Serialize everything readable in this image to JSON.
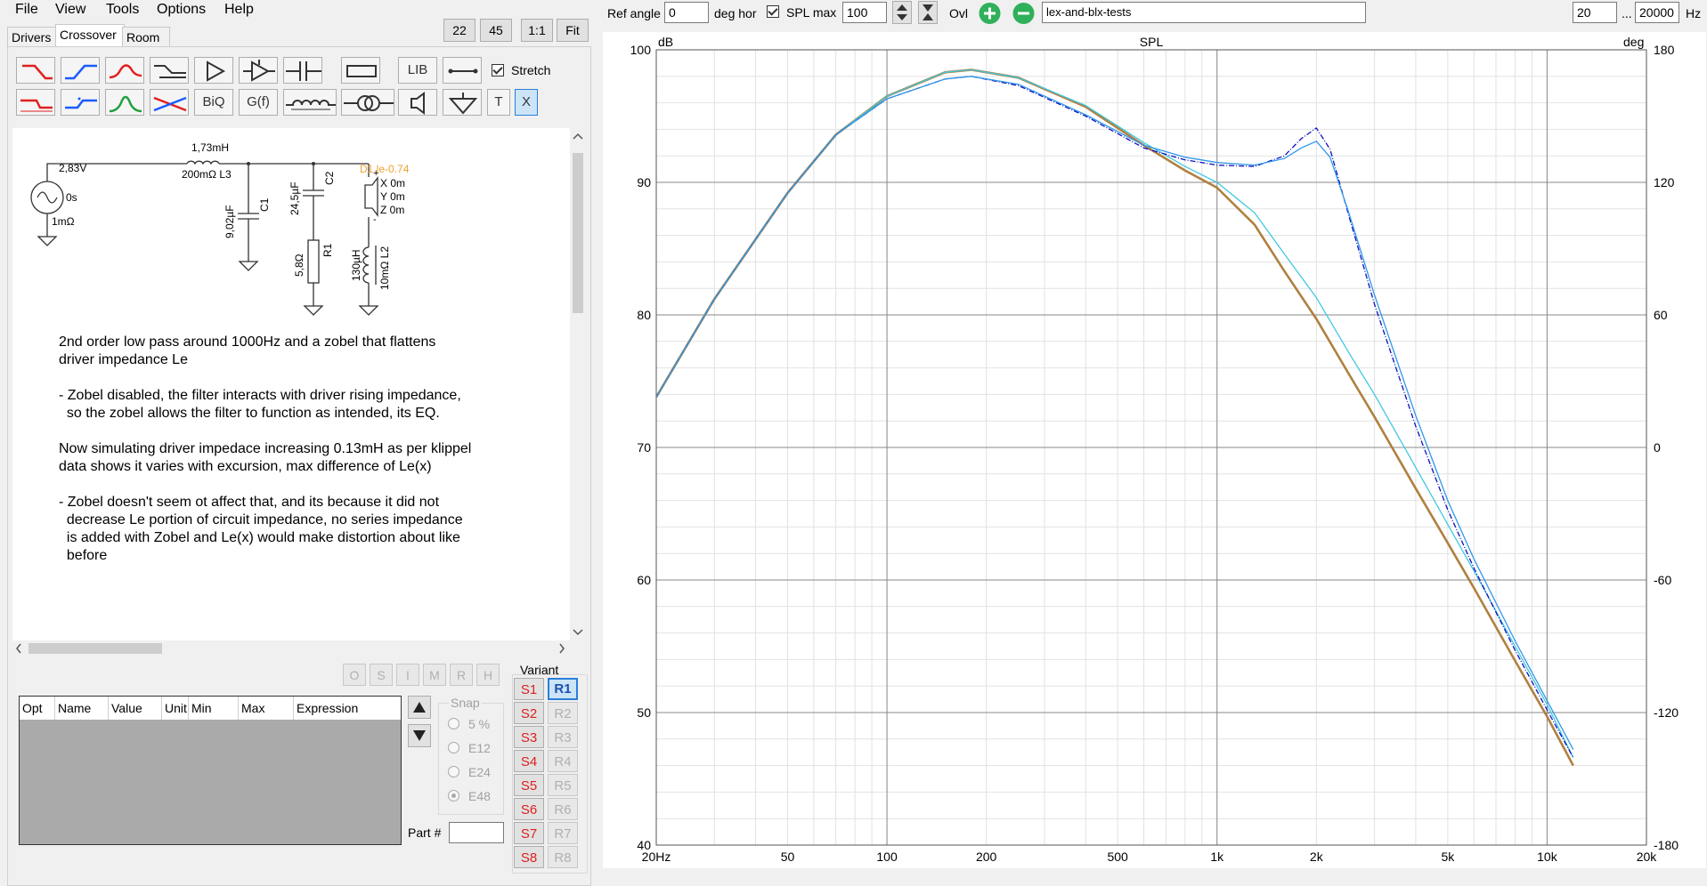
{
  "menu": {
    "items": [
      "File",
      "View",
      "Tools",
      "Options",
      "Help"
    ]
  },
  "tabs": [
    "Drivers",
    "Crossover",
    "Room"
  ],
  "active_tab": "Crossover",
  "zoom": {
    "b1": "22",
    "b2": "45",
    "b3": "1:1",
    "b4": "Fit"
  },
  "toolbar": {
    "lib": "LIB",
    "biq": "BiQ",
    "gf": "G(f)",
    "t": "T",
    "x": "X",
    "stretch_label": "Stretch"
  },
  "schematic": {
    "source_voltage": "2,83V",
    "source_delay": "0s",
    "source_res": "1mΩ",
    "l3_value": "1,73mH",
    "l3_label": "200mΩ L3",
    "c1_value": "9,02µF",
    "c1_name": "C1",
    "c2_value": "24,5µF",
    "c2_name": "C2",
    "r1_value": "5,8Ω",
    "r1_name": "R1",
    "l2_value": "130µH",
    "l2_label": "10mΩ L2",
    "driver_name": "D1 le-0.74",
    "driver_x": "X 0m",
    "driver_y": "Y 0m",
    "driver_z": "Z 0m"
  },
  "notes": [
    "2nd order low pass around 1000Hz and a zobel that flattens",
    "driver impedance Le",
    "",
    "- Zobel disabled, the filter interacts with driver rising impedance,",
    "  so the zobel allows the filter to function as intended, its EQ.",
    "",
    "Now simulating driver impedace increasing 0.13mH as per klippel",
    "data shows it varies with excursion, max difference of Le(x)",
    "",
    "- Zobel doesn't seem ot affect that, and its because it did not",
    "  decrease Le portion of circuit impedance, no series impedance",
    "  is added with Zobel and Le(x) would make distortion about like",
    "  before"
  ],
  "opt_table": {
    "columns": [
      "Opt",
      "Name",
      "Value",
      "Unit",
      "Min",
      "Max",
      "Expression"
    ]
  },
  "omrh": [
    "O",
    "S",
    "I",
    "M",
    "R",
    "H"
  ],
  "snap": {
    "label": "Snap",
    "options": [
      "5 %",
      "E12",
      "E24",
      "E48"
    ],
    "selected": "E48"
  },
  "part_label": "Part #",
  "variant": {
    "label": "Variant",
    "s": [
      "S1",
      "S2",
      "S3",
      "S4",
      "S5",
      "S6",
      "S7",
      "S8"
    ],
    "r": [
      "R1",
      "R2",
      "R3",
      "R4",
      "R5",
      "R6",
      "R7",
      "R8"
    ],
    "selected": "R1"
  },
  "topbar": {
    "ref_angle_label": "Ref angle",
    "ref_angle_value": "0",
    "deg_hor": "deg hor",
    "spl_max_label": "SPL max",
    "spl_max_value": "100",
    "ovl_label": "Ovl",
    "project": "lex-and-blx-tests",
    "f_min": "20",
    "ellipsis": "...",
    "f_max": "20000",
    "hz": "Hz"
  },
  "chart_data": {
    "type": "line",
    "title": "SPL",
    "x_scale": "log",
    "xlim": [
      20,
      20000
    ],
    "ylim": [
      40,
      100
    ],
    "ylim_right": [
      -180,
      180
    ],
    "ylabel": "dB",
    "ylabel_right": "deg",
    "x_ticks": [
      "20Hz",
      "50",
      "100",
      "200",
      "500",
      "1k",
      "2k",
      "5k",
      "10k",
      "20k"
    ],
    "x_tick_values": [
      20,
      50,
      100,
      200,
      500,
      1000,
      2000,
      5000,
      10000,
      20000
    ],
    "y_ticks": [
      40,
      50,
      60,
      70,
      80,
      90,
      100
    ],
    "y_ticks_right": [
      -180,
      -120,
      -60,
      0,
      60,
      120,
      180
    ],
    "grid": true,
    "series": [
      {
        "color": "#b08040",
        "x": [
          20,
          30,
          50,
          70,
          100,
          150,
          180,
          250,
          400,
          600,
          800,
          1000,
          1300,
          1600,
          2000,
          2500,
          3000,
          4000,
          5000,
          6000,
          8000,
          10000,
          12000
        ],
        "y": [
          73.8,
          81.2,
          89.2,
          93.6,
          96.5,
          98.3,
          98.5,
          97.9,
          95.7,
          92.8,
          90.9,
          89.6,
          86.8,
          83.3,
          79.7,
          75.6,
          72.3,
          66.9,
          62.8,
          59.4,
          53.9,
          49.7,
          46.0
        ]
      },
      {
        "color": "#40c8e0",
        "x": [
          20,
          30,
          50,
          70,
          100,
          150,
          180,
          250,
          400,
          600,
          800,
          1000,
          1300,
          1600,
          2000,
          2500,
          3000,
          4000,
          5000,
          6000,
          8000,
          10000,
          12000
        ],
        "y": [
          73.8,
          81.2,
          89.2,
          93.6,
          96.5,
          98.3,
          98.5,
          97.9,
          95.8,
          93.0,
          91.2,
          90.0,
          87.7,
          84.6,
          81.3,
          77.2,
          74.0,
          68.5,
          64.2,
          60.7,
          55.0,
          50.6,
          46.6
        ]
      },
      {
        "color": "#1010c0",
        "x": [
          20,
          30,
          50,
          70,
          100,
          150,
          180,
          250,
          400,
          600,
          800,
          1000,
          1300,
          1600,
          1800,
          2000,
          2200,
          2500,
          3000,
          4000,
          5000,
          6000,
          8000,
          10000,
          12000
        ],
        "y": [
          73.8,
          81.2,
          89.2,
          93.6,
          96.3,
          97.8,
          98.0,
          97.3,
          95.0,
          92.6,
          91.7,
          91.3,
          91.2,
          92.0,
          93.3,
          94.1,
          92.5,
          87.6,
          80.8,
          71.6,
          65.3,
          60.9,
          54.7,
          50.2,
          46.6
        ]
      },
      {
        "color": "#3098e8",
        "x": [
          20,
          30,
          50,
          70,
          100,
          150,
          180,
          250,
          400,
          600,
          800,
          1000,
          1300,
          1600,
          1800,
          2000,
          2200,
          2500,
          3000,
          4000,
          5000,
          6000,
          8000,
          10000,
          12000
        ],
        "y": [
          73.8,
          81.2,
          89.2,
          93.6,
          96.3,
          97.8,
          98.0,
          97.4,
          95.1,
          92.8,
          91.9,
          91.5,
          91.3,
          91.8,
          92.6,
          93.1,
          91.9,
          87.8,
          81.5,
          72.4,
          66.0,
          61.6,
          55.4,
          50.9,
          47.2
        ]
      }
    ]
  }
}
